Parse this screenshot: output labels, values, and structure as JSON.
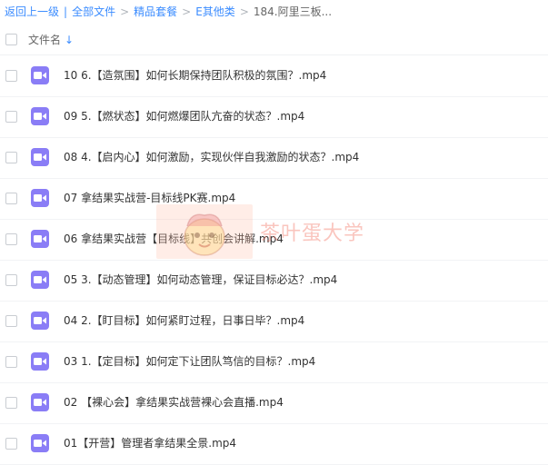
{
  "breadcrumb": {
    "back": "返回上一级",
    "separator": "|",
    "items": [
      "全部文件",
      "精品套餐",
      "E其他类"
    ],
    "arrow": ">",
    "current": "184.阿里三板..."
  },
  "list_header": {
    "column_title": "文件名",
    "sort_icon": "↓"
  },
  "files": [
    "10 6.【造氛围】如何长期保持团队积极的氛围？.mp4",
    "09 5.【燃状态】如何燃爆团队亢奋的状态？.mp4",
    "08 4.【启内心】如何激励，实现伙伴自我激励的状态？.mp4",
    "07 拿结果实战营-目标线PK赛.mp4",
    "06 拿结果实战营【目标线】共创会讲解.mp4",
    "05 3.【动态管理】如何动态管理，保证目标必达？.mp4",
    "04 2.【盯目标】如何紧盯过程，日事日毕？.mp4",
    "03 1.【定目标】如何定下让团队笃信的目标？.mp4",
    "02 【裸心会】拿结果实战营裸心会直播.mp4",
    "01【开营】管理者拿结果全景.mp4"
  ],
  "icons": {
    "file_type": "video-file-icon"
  },
  "colors": {
    "link": "#3b8cff",
    "video_icon": "#8a7df6"
  },
  "watermark": {
    "text": "茶叶蛋大学"
  }
}
